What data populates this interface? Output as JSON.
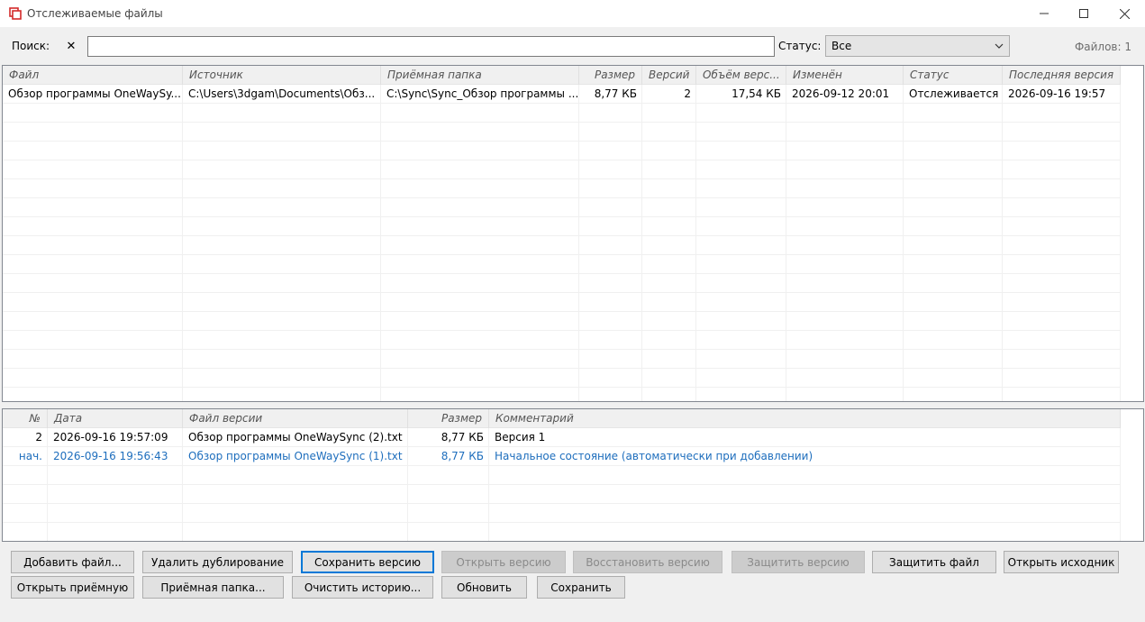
{
  "window": {
    "title": "Отслеживаемые файлы"
  },
  "filter": {
    "search_label": "Поиск:",
    "search_value": "",
    "clear_glyph": "✕",
    "status_label": "Статус:",
    "status_value": "Все",
    "files_count": "Файлов: 1"
  },
  "files_table": {
    "columns": [
      "Файл",
      "Источник",
      "Приёмная папка",
      "Размер",
      "Версий",
      "Объём верс...",
      "Изменён",
      "Статус",
      "Последняя версия"
    ],
    "rows": [
      [
        "Обзор программы OneWaySy...",
        "C:\\Users\\3dgam\\Documents\\Обз...",
        "C:\\Sync\\Sync_Обзор программы ...",
        "8,77 КБ",
        "2",
        "17,54 КБ",
        "2026-09-12 20:01",
        "Отслеживается",
        "2026-09-16 19:57"
      ]
    ]
  },
  "versions_table": {
    "columns": [
      "№",
      "Дата",
      "Файл версии",
      "Размер",
      "Комментарий"
    ],
    "rows": [
      [
        "2",
        "2026-09-16 19:57:09",
        "Обзор программы OneWaySync (2).txt",
        "8,77 КБ",
        "Версия 1"
      ],
      [
        "нач.",
        "2026-09-16 19:56:43",
        "Обзор программы OneWaySync (1).txt",
        "8,77 КБ",
        "Начальное состояние (автоматически при добавлении)"
      ]
    ]
  },
  "buttons": {
    "add_file": "Добавить файл...",
    "remove_duplicates": "Удалить дублирование",
    "save_version": "Сохранить версию",
    "open_version": "Открыть версию",
    "restore_version": "Восстановить версию",
    "protect_version": "Защитить версию",
    "protect_file": "Защитить файл",
    "open_source": "Открыть исходник",
    "open_target": "Открыть приёмную",
    "target_folder": "Приёмная папка...",
    "clear_history": "Очистить историю...",
    "refresh": "Обновить",
    "save": "Сохранить"
  },
  "colors": {
    "accent": "#0078d7",
    "link_row": "#1e6ebd",
    "app_icon": "#d42a2a"
  }
}
